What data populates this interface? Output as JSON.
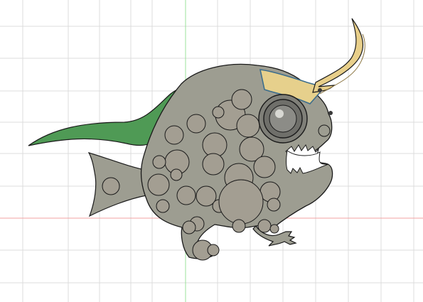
{
  "viewport": {
    "background": "#ffffff",
    "grid_color": "#dcdcdc",
    "x_axis_color": "#f3a3a3",
    "y_axis_color": "#9be39b"
  },
  "model": {
    "body_color": "#9d9d91",
    "spot_color": "#a39e92",
    "outline_color": "#1a1a1a",
    "fin_color": "#4f9a55",
    "horn_color": "#e8cf8a",
    "helmet_band_color": "#e6d08c",
    "selection_edge_color": "#3d6e8c",
    "eye_color": "#8c8c87"
  }
}
